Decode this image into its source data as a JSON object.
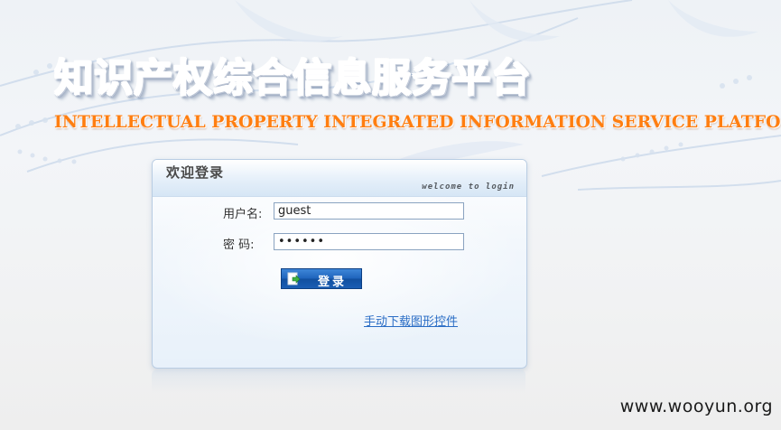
{
  "header": {
    "title_cn": "知识产权综合信息服务平台",
    "title_en": "INTELLECTUAL PROPERTY INTEGRATED INFORMATION SERVICE PLATFORM"
  },
  "login": {
    "title": "欢迎登录",
    "subtitle": "welcome to login",
    "username_label": "用户名:",
    "username_value": "guest",
    "password_label": "密 码:",
    "password_value": "••••••",
    "submit_label": "登录",
    "download_link": "手动下载图形控件"
  },
  "watermark": "www.wooyun.org",
  "colors": {
    "title_blue": "#1e57a5",
    "title_orange": "#ff7e10",
    "button_blue": "#1e63bb",
    "link_blue": "#2a6dc5"
  }
}
